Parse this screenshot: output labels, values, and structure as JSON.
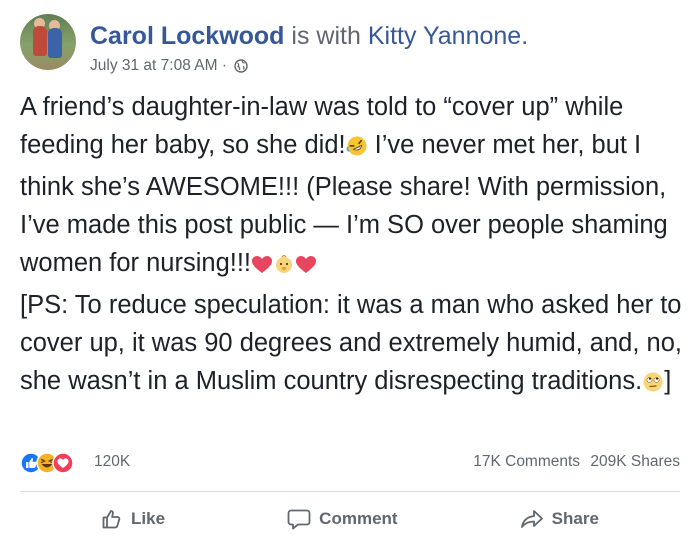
{
  "post": {
    "author": "Carol Lockwood",
    "with_text": "is with",
    "tagged": "Kitty Yannone.",
    "timestamp": "July 31 at 7:08 AM",
    "separator": "·",
    "privacy_icon": "globe-icon",
    "paragraph1_part1": "A friend’s daughter-in-law was told to “cover up” while feeding her baby, so she did!",
    "paragraph1_part2": " I’ve never met her, but I think she’s AWESOME!!! (Please share! With permission, I’ve made this post public — I’m SO over people shaming women for nursing!!!",
    "paragraph2_part1": "[PS: To reduce speculation: it was a man who asked her to cover up, it was 90 degrees and extremely humid, and, no, she wasn’t in a Muslim country disrespecting traditions.",
    "paragraph2_part2": "]",
    "emojis": [
      "rolling-laughing-emoji",
      "heart-emoji",
      "baby-emoji",
      "heart-emoji",
      "rolling-eyes-emoji"
    ]
  },
  "stats": {
    "reactions": [
      "like",
      "haha",
      "love"
    ],
    "reaction_count": "120K",
    "comments": "17K Comments",
    "shares": "209K Shares"
  },
  "actions": {
    "like": "Like",
    "comment": "Comment",
    "share": "Share"
  },
  "colors": {
    "link": "#365899",
    "text": "#1d2129",
    "meta": "#616770",
    "like_blue": "#1877f2",
    "love_red": "#f33e58",
    "haha_yellow": "#f7b125"
  }
}
